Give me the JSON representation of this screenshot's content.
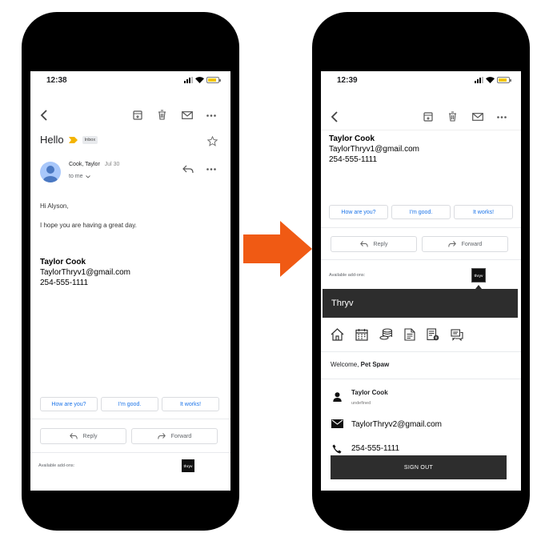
{
  "left": {
    "status": {
      "time": "12:38"
    },
    "subject": "Hello",
    "label_badge": "Inbox",
    "sender": {
      "name": "Cook, Taylor",
      "date": "Jul 30",
      "to": "to me"
    },
    "body": {
      "greeting": "Hi Alyson,",
      "line1": "I hope you are having a great day."
    },
    "signature": {
      "name": "Taylor Cook",
      "email": "TaylorThryv1@gmail.com",
      "phone": "254-555-1111"
    },
    "smart_replies": [
      "How are you?",
      "I'm good.",
      "It works!"
    ],
    "actions": {
      "reply": "Reply",
      "forward": "Forward"
    },
    "addons": {
      "label": "Available add-ons:",
      "tile": "thryv"
    }
  },
  "right": {
    "status": {
      "time": "12:39"
    },
    "signature": {
      "name": "Taylor Cook",
      "email": "TaylorThryv1@gmail.com",
      "phone": "254-555-1111"
    },
    "smart_replies": [
      "How are you?",
      "I'm good.",
      "It works!"
    ],
    "actions": {
      "reply": "Reply",
      "forward": "Forward"
    },
    "addons": {
      "label": "Available add-ons:",
      "tile": "thryv"
    },
    "panel": {
      "title": "Thryv",
      "welcome_prefix": "Welcome,",
      "welcome_name": "Pet Spaw",
      "contact": {
        "name": "Taylor Cook",
        "sub": "undefined",
        "email": "TaylorThryv2@gmail.com",
        "phone": "254-555-1111"
      },
      "sign_out": "SIGN OUT"
    }
  },
  "colors": {
    "accent_blue": "#1a73e8",
    "arrow": "#f05a14",
    "gmail_label": "#f4b400",
    "dark_panel": "#2d2d2d"
  },
  "icons": [
    "back-icon",
    "archive-icon",
    "trash-icon",
    "mail-icon",
    "more-icon",
    "star-icon",
    "reply-icon",
    "forward-icon",
    "important-label-icon",
    "avatar-icon",
    "home-icon",
    "calendar-icon",
    "coins-icon",
    "document-icon",
    "invoice-icon",
    "chat-icon",
    "person-icon",
    "envelope-icon",
    "phone-icon"
  ]
}
